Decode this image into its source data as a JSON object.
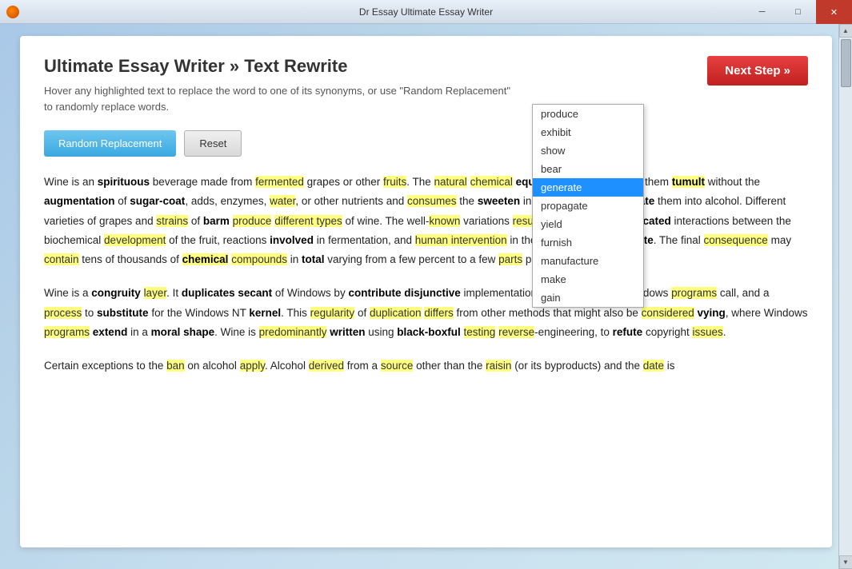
{
  "window": {
    "title": "Dr Essay Ultimate Essay Writer",
    "controls": {
      "minimize": "─",
      "restore": "□",
      "close": "✕"
    }
  },
  "header": {
    "title": "Ultimate Essay Writer » Text Rewrite",
    "subtitle": "Hover any highlighted text to replace the word to one of its synonyms, or use \"Random Replacement\"",
    "subtitle2": "to randomly replace words."
  },
  "buttons": {
    "random_replacement": "Random Replacement",
    "reset": "Reset",
    "next_step": "Next Step »"
  },
  "dropdown": {
    "items": [
      {
        "label": "produce",
        "selected": false
      },
      {
        "label": "exhibit",
        "selected": false
      },
      {
        "label": "show",
        "selected": false
      },
      {
        "label": "bear",
        "selected": false
      },
      {
        "label": "generate",
        "selected": true
      },
      {
        "label": "propagate",
        "selected": false
      },
      {
        "label": "yield",
        "selected": false
      },
      {
        "label": "furnish",
        "selected": false
      },
      {
        "label": "manufacture",
        "selected": false
      },
      {
        "label": "make",
        "selected": false
      },
      {
        "label": "gain",
        "selected": false
      }
    ]
  },
  "essay": {
    "paragraph1": "Wine is an spirituous beverage made from fermented grapes or other fruits. The natural chemical equilibrium of grapes lets them tumult without the augmentation of sugar-coat, adds, enzymes, water, or other nutrients and consumes the sweeten in the grapes and translate them into alcohol. Different varieties of grapes and strains of barm produce different types of wine. The well-known variations result from the very complicated interactions between the biochemical development of the fruit, reactions involved in fermentation, and human intervention in the everywhere prosecute. The final consequence may contain tens of thousands of chemical compounds in total varying from a few percent to a few parts per billion.",
    "paragraph2": "Wine is a congruity layer. It duplicates secant of Windows by contribute disjunctive implementations of the DLLs that Windows programs call, and a process to substitute for the Windows NT kernel. This regularity of duplication differs from other methods that might also be considered vying, where Windows programs extend in a moral shape. Wine is predominantly written using black-boxful testing reverse-engineering, to refute copyright issues.",
    "paragraph3": "Certain exceptions to the ban on alcohol apply. Alcohol derived from a source other than a raisin (or its byproducts) and the date is"
  }
}
